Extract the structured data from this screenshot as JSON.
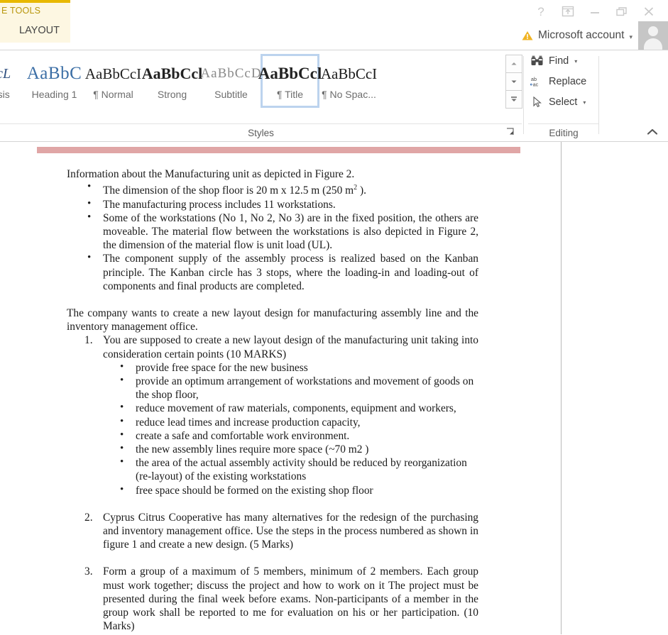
{
  "window": {
    "contextual_tab_group": "E TOOLS",
    "contextual_tab": "LAYOUT",
    "buttons": {
      "help": "?",
      "ribbon_display_options": "ribbon-display-options-icon",
      "minimize": "minimize-icon",
      "restore": "restore-icon",
      "close": "close-icon"
    },
    "account": {
      "warning_icon": "warning-triangle-icon",
      "label": "Microsoft account",
      "caret": "▾",
      "avatar": "user-avatar"
    }
  },
  "ribbon": {
    "styles_group": {
      "label": "Styles",
      "dialog_launcher": "dialog-launcher-icon",
      "gallery": [
        {
          "sample": "bCcL",
          "name": "phasis",
          "selected": false
        },
        {
          "sample": "AaBbC",
          "name": "Heading 1",
          "selected": false
        },
        {
          "sample": "AaBbCcI",
          "name": "¶ Normal",
          "selected": false
        },
        {
          "sample": "AaBbCcl",
          "name": "Strong",
          "selected": false
        },
        {
          "sample": "AaBbCcD",
          "name": "Subtitle",
          "selected": false
        },
        {
          "sample": "AaBbCcl",
          "name": "¶ Title",
          "selected": true
        },
        {
          "sample": "AaBbCcI",
          "name": "¶ No Spac...",
          "selected": false
        }
      ],
      "scroll_up": "scroll-up-icon",
      "scroll_down": "scroll-down-icon",
      "more_styles": "more-styles-icon"
    },
    "editing_group": {
      "label": "Editing",
      "items": [
        {
          "icon": "binoculars-icon",
          "label": "Find",
          "caret": "▾"
        },
        {
          "icon": "replace-icon",
          "label": "Replace",
          "caret": ""
        },
        {
          "icon": "select-cursor-icon",
          "label": "Select",
          "caret": "▾"
        }
      ]
    },
    "collapse_ribbon": "collapse-ribbon-chevron"
  },
  "document": {
    "lead": "Information about the Manufacturing unit as depicted in Figure 2.",
    "bullets_top": [
      "The dimension of the shop floor is 20 m x 12.5 m (250 m2 ).",
      "The manufacturing process includes 11 workstations.",
      "Some of the workstations (No 1, No 2, No 3) are in the fixed position, the others are moveable. The material flow between the workstations is also depicted in Figure 2, the dimension of the material flow is unit load (UL).",
      "The component supply of the assembly process is realized based on the Kanban principle. The Kanban circle has 3 stops, where the loading-in and loading-out of components and final products are completed."
    ],
    "para_company": "The company wants to create a new layout design for manufacturing assembly line and the inventory management office.",
    "item1": "You are supposed to create a new layout design of the manufacturing unit taking into consideration certain points (10 MARKS)",
    "item1_subbullets": [
      "provide free space for the new business",
      "provide an optimum arrangement of workstations and movement of goods on the shop floor,",
      "reduce movement of raw materials, components, equipment and workers,",
      "reduce lead times and increase production capacity,",
      "create a safe and comfortable work environment.",
      "the new assembly lines require more space (~70 m2 )",
      "the area of the actual assembly activity should be reduced by reorganization (re-layout) of the existing workstations",
      "free space should be formed on the existing shop floor"
    ],
    "item2": "Cyprus Citrus Cooperative has many alternatives for the redesign of the purchasing and inventory management office. Use the steps in the process numbered as shown in figure 1 and create a new design. (5 Marks)",
    "item3": "Form a group of a maximum of 5 members, minimum of 2 members. Each group must work together; discuss the project and how to work on it The project must be presented during the final week before exams. Non-participants of a member in the group work shall be reported to me for evaluation on his or her participation. (10 Marks)"
  },
  "colors": {
    "contextual_accent": "#e8b800",
    "contextual_tab_bg": "#fdf7e2",
    "selection_border": "#bcd3ee",
    "highlight_bar": "#e0a6a6"
  }
}
